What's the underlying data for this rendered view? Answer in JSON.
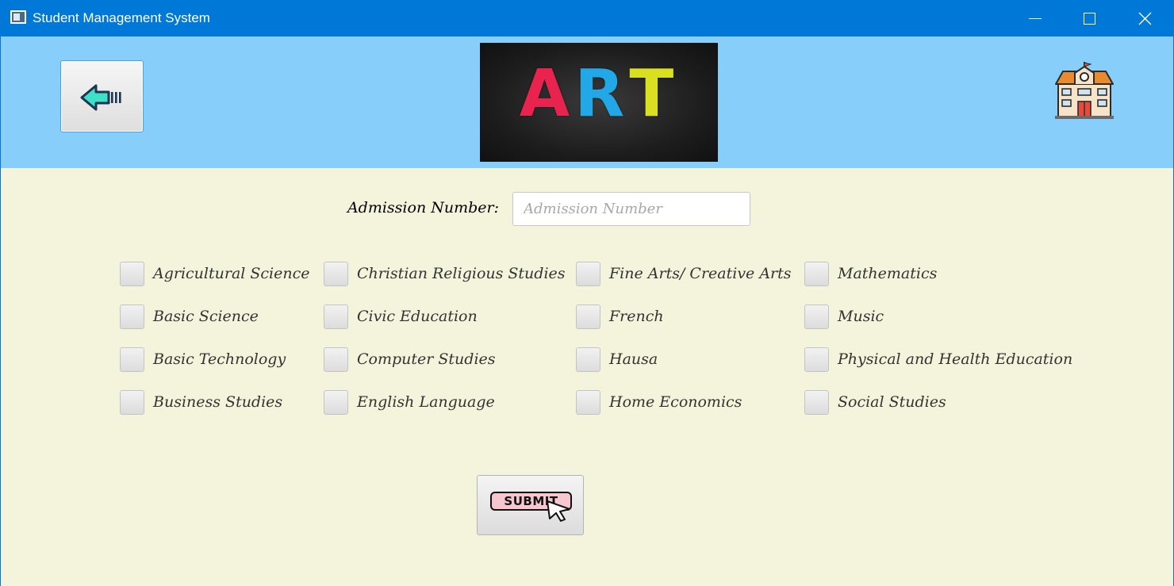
{
  "window": {
    "title": "Student Management System",
    "controls": {
      "minimize": "minimize",
      "maximize": "maximize",
      "close": "close"
    }
  },
  "header": {
    "back_icon": "arrow-left-icon",
    "banner_text": [
      "A",
      "R",
      "T"
    ],
    "school_icon": "school-building-icon"
  },
  "form": {
    "admission_label": "Admission Number:",
    "admission_placeholder": "Admission Number",
    "admission_value": ""
  },
  "subjects": [
    "Agricultural Science",
    "Basic Science",
    "Basic Technology",
    "Business Studies",
    "Christian Religious Studies",
    "Civic Education",
    "Computer Studies",
    "English Language",
    "Fine Arts/ Creative Arts",
    "French",
    "Hausa",
    "Home Economics",
    "Mathematics",
    "Music",
    "Physical and Health Education",
    "Social Studies"
  ],
  "submit": {
    "label": "SUBMIT",
    "icon": "cursor-icon"
  },
  "colors": {
    "titlebar": "#0078d7",
    "header_bg": "#87cefa",
    "body_bg": "#f4f4dc",
    "submit_badge": "#f7c7cf"
  }
}
